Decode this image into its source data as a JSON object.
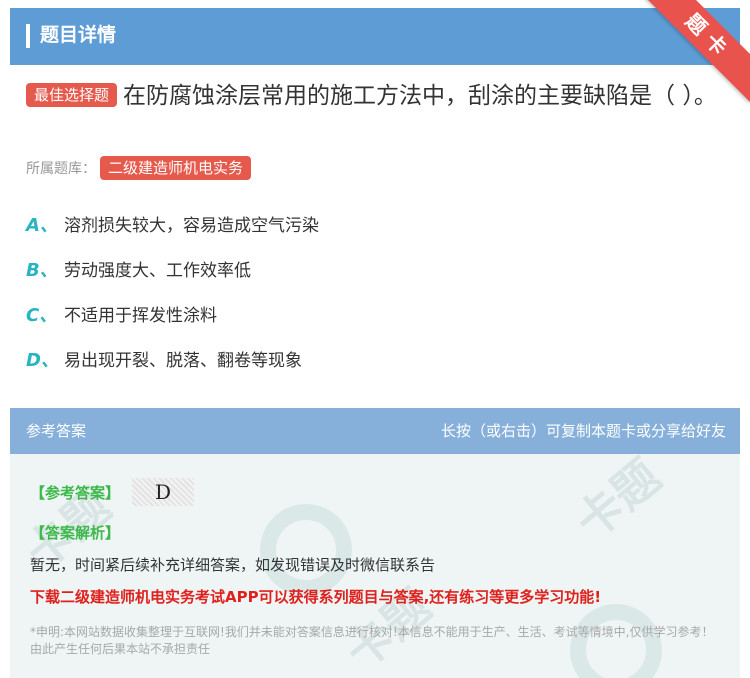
{
  "header": {
    "title": "题目详情",
    "ribbon": "题卡"
  },
  "question": {
    "tag": "最佳选择题",
    "text": "在防腐蚀涂层常用的施工方法中，刮涂的主要缺陷是（    ）。"
  },
  "source": {
    "label": "所属题库：",
    "bank": "二级建造师机电实务"
  },
  "options": [
    {
      "letter": "A、",
      "text": "溶剂损失较大，容易造成空气污染"
    },
    {
      "letter": "B、",
      "text": "劳动强度大、工作效率低"
    },
    {
      "letter": "C、",
      "text": "不适用于挥发性涂料"
    },
    {
      "letter": "D、",
      "text": "易出现开裂、脱落、翻卷等现象"
    }
  ],
  "answer_section": {
    "title": "参考答案",
    "hint": "长按（或右击）可复制本题卡或分享给好友",
    "answer_label": "【参考答案】",
    "answer_value": "D",
    "explanation_label": "【答案解析】",
    "explanation": "暂无，时间紧后续补充详细答案，如发现错误及时微信联系告",
    "promo": "下载二级建造师机电实务考试APP可以获得系列题目与答案,还有练习等更多学习功能!",
    "disclaimer": "*申明:本网站数据收集整理于互联网!我们并未能对答案信息进行核对!本信息不能用于生产、生活、考试等情境中,仅供学习参考！由此产生任何后果本站不承担责任"
  },
  "colors": {
    "header": "#5e9cd6",
    "answer_header": "#86b0da",
    "tag": "#e55a4c",
    "option_letter": "#2ab3c0",
    "promo": "#e0201c",
    "green": "#3cb94a"
  }
}
